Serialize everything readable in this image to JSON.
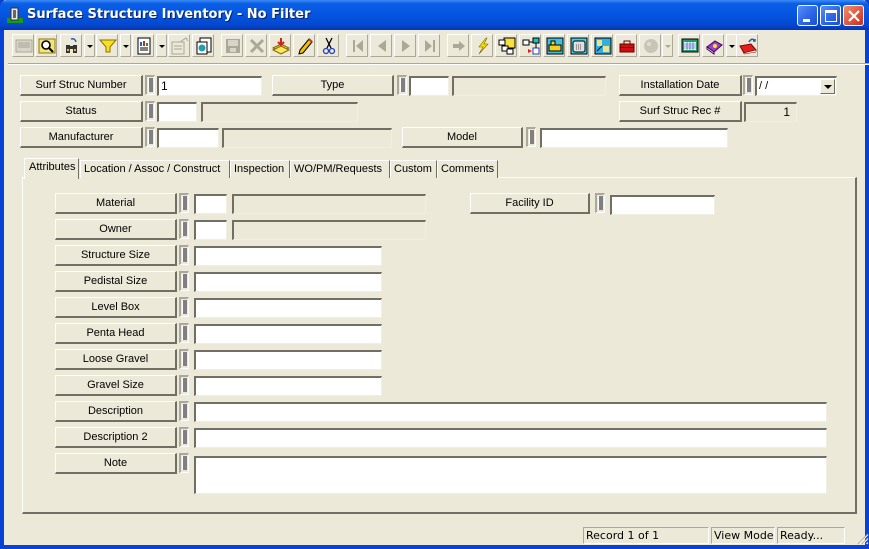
{
  "window": {
    "title": "Surface Structure Inventory - No Filter",
    "controls": {
      "minimize": "minimize",
      "maximize": "maximize",
      "close": "close"
    }
  },
  "toolbar": {
    "buttons": [
      {
        "name": "new-record",
        "icon": "new-record-icon",
        "enabled": false
      },
      {
        "name": "search",
        "icon": "search-map-icon",
        "enabled": true
      },
      {
        "name": "find",
        "icon": "binoculars-icon",
        "enabled": true,
        "dropdown": true
      },
      {
        "name": "filter",
        "icon": "filter-funnel-icon",
        "enabled": true,
        "dropdown": true
      },
      {
        "name": "report",
        "icon": "report-icon",
        "enabled": true,
        "dropdown": true
      },
      {
        "name": "properties",
        "icon": "properties-icon",
        "enabled": false
      },
      {
        "name": "copy-record",
        "icon": "copy-record-icon",
        "enabled": true
      },
      {
        "name": "save",
        "icon": "save-icon",
        "enabled": false
      },
      {
        "name": "delete",
        "icon": "delete-icon",
        "enabled": false
      },
      {
        "name": "load",
        "icon": "stack-download-icon",
        "enabled": true
      },
      {
        "name": "edit",
        "icon": "pencil-icon",
        "enabled": true
      },
      {
        "name": "cut",
        "icon": "scissors-icon",
        "enabled": true
      },
      {
        "name": "first-record",
        "icon": "first-record-icon",
        "enabled": false
      },
      {
        "name": "previous-record",
        "icon": "previous-record-icon",
        "enabled": false
      },
      {
        "name": "next-record",
        "icon": "next-record-icon",
        "enabled": false
      },
      {
        "name": "last-record",
        "icon": "last-record-icon",
        "enabled": false
      },
      {
        "name": "go-to",
        "icon": "arrow-right-icon",
        "enabled": false
      },
      {
        "name": "execute",
        "icon": "lightning-icon",
        "enabled": true
      },
      {
        "name": "hierarchy",
        "icon": "hierarchy-icon",
        "enabled": true
      },
      {
        "name": "relationships",
        "icon": "relationship-icon",
        "enabled": true
      },
      {
        "name": "equipment",
        "icon": "equipment-icon",
        "enabled": true
      },
      {
        "name": "calculator",
        "icon": "calculator-icon",
        "enabled": true
      },
      {
        "name": "map",
        "icon": "map-icon",
        "enabled": true
      },
      {
        "name": "toolbox",
        "icon": "toolbox-icon",
        "enabled": true
      },
      {
        "name": "globe",
        "icon": "globe-icon",
        "enabled": false,
        "dropdown": true
      },
      {
        "name": "spreadsheet",
        "icon": "spreadsheet-icon",
        "enabled": true
      },
      {
        "name": "help-book",
        "icon": "book-icon",
        "enabled": true,
        "dropdown": true
      },
      {
        "name": "exit",
        "icon": "exit-icon",
        "enabled": true
      }
    ]
  },
  "header_fields": {
    "surf_struc_number": {
      "label": "Surf Struc Number",
      "value": "1"
    },
    "type": {
      "label": "Type",
      "code": "",
      "description": ""
    },
    "installation_date": {
      "label": "Installation Date",
      "value": " /  /"
    },
    "status": {
      "label": "Status",
      "code": "",
      "description": ""
    },
    "surf_struc_rec": {
      "label": "Surf Struc Rec #",
      "value": "1"
    },
    "manufacturer": {
      "label": "Manufacturer",
      "code": "",
      "description": ""
    },
    "model": {
      "label": "Model",
      "value": ""
    }
  },
  "tabs": [
    {
      "label": "Attributes",
      "active": true
    },
    {
      "label": "Location / Assoc / Construct",
      "active": false
    },
    {
      "label": "Inspection",
      "active": false
    },
    {
      "label": "WO/PM/Requests",
      "active": false
    },
    {
      "label": "Custom",
      "active": false
    },
    {
      "label": "Comments",
      "active": false
    }
  ],
  "attributes": {
    "material": {
      "label": "Material",
      "code": "",
      "description": ""
    },
    "owner": {
      "label": "Owner",
      "code": "",
      "description": ""
    },
    "facility_id": {
      "label": "Facility ID",
      "value": ""
    },
    "structure_size": {
      "label": "Structure Size",
      "value": ""
    },
    "pedistal_size": {
      "label": "Pedistal Size",
      "value": ""
    },
    "level_box": {
      "label": "Level Box",
      "value": ""
    },
    "penta_head": {
      "label": "Penta Head",
      "value": ""
    },
    "loose_gravel": {
      "label": "Loose Gravel",
      "value": ""
    },
    "gravel_size": {
      "label": "Gravel Size",
      "value": ""
    },
    "description": {
      "label": "Description",
      "value": ""
    },
    "description_2": {
      "label": "Description 2",
      "value": ""
    },
    "note": {
      "label": "Note",
      "value": ""
    }
  },
  "statusbar": {
    "record": "Record 1 of 1",
    "mode": "View Mode",
    "state": "Ready..."
  }
}
